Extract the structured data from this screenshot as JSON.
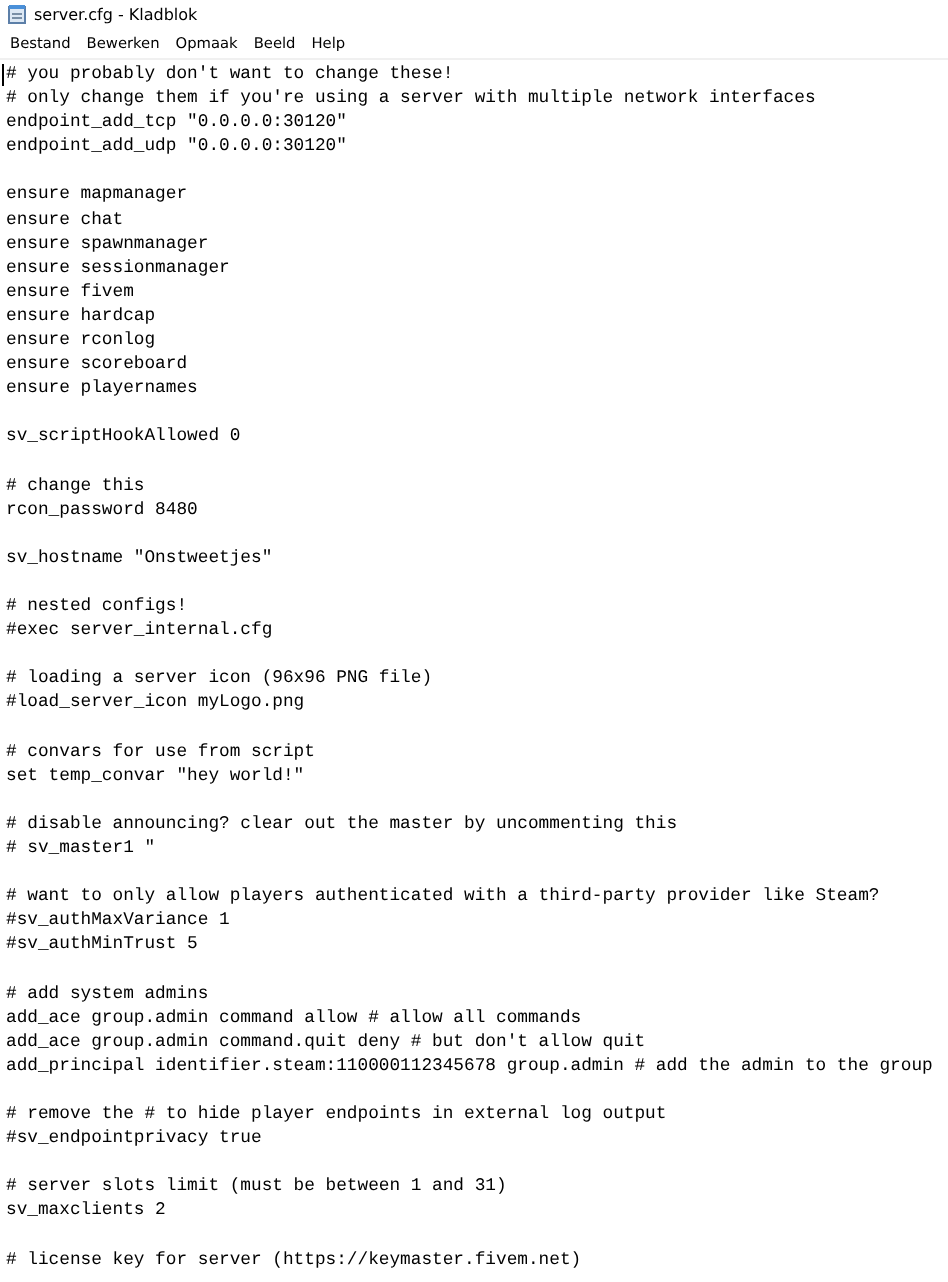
{
  "window": {
    "title": "server.cfg - Kladblok"
  },
  "menu": [
    "Bestand",
    "Bewerken",
    "Opmaak",
    "Beeld",
    "Help"
  ],
  "editor": {
    "blocks": [
      [
        "# you probably don't want to change these!",
        "# only change them if you're using a server with multiple network interfaces",
        "endpoint_add_tcp \"0.0.0.0:30120\"",
        "endpoint_add_udp \"0.0.0.0:30120\""
      ],
      [
        "ensure mapmanager",
        "ensure chat",
        "ensure spawnmanager",
        "ensure sessionmanager",
        "ensure fivem",
        "ensure hardcap",
        "ensure rconlog",
        "ensure scoreboard",
        "ensure playernames"
      ],
      [
        "sv_scriptHookAllowed 0"
      ],
      [
        "# change this",
        "rcon_password 8480"
      ],
      [
        "sv_hostname \"Onstweetjes\""
      ],
      [
        "# nested configs!",
        "#exec server_internal.cfg"
      ],
      [
        "# loading a server icon (96x96 PNG file)",
        "#load_server_icon myLogo.png"
      ],
      [
        "# convars for use from script",
        "set temp_convar \"hey world!\""
      ],
      [
        "# disable announcing? clear out the master by uncommenting this",
        "# sv_master1 \""
      ],
      [
        "# want to only allow players authenticated with a third-party provider like Steam?",
        "#sv_authMaxVariance 1",
        "#sv_authMinTrust 5"
      ],
      [
        "# add system admins",
        "add_ace group.admin command allow # allow all commands",
        "add_ace group.admin command.quit deny # but don't allow quit",
        "add_principal identifier.steam:110000112345678 group.admin # add the admin to the group"
      ],
      [
        "# remove the # to hide player endpoints in external log output",
        "#sv_endpointprivacy true"
      ],
      [
        "# server slots limit (must be between 1 and 31)",
        "sv_maxclients 2"
      ],
      [
        "# license key for server (https://keymaster.fivem.net)"
      ]
    ]
  }
}
